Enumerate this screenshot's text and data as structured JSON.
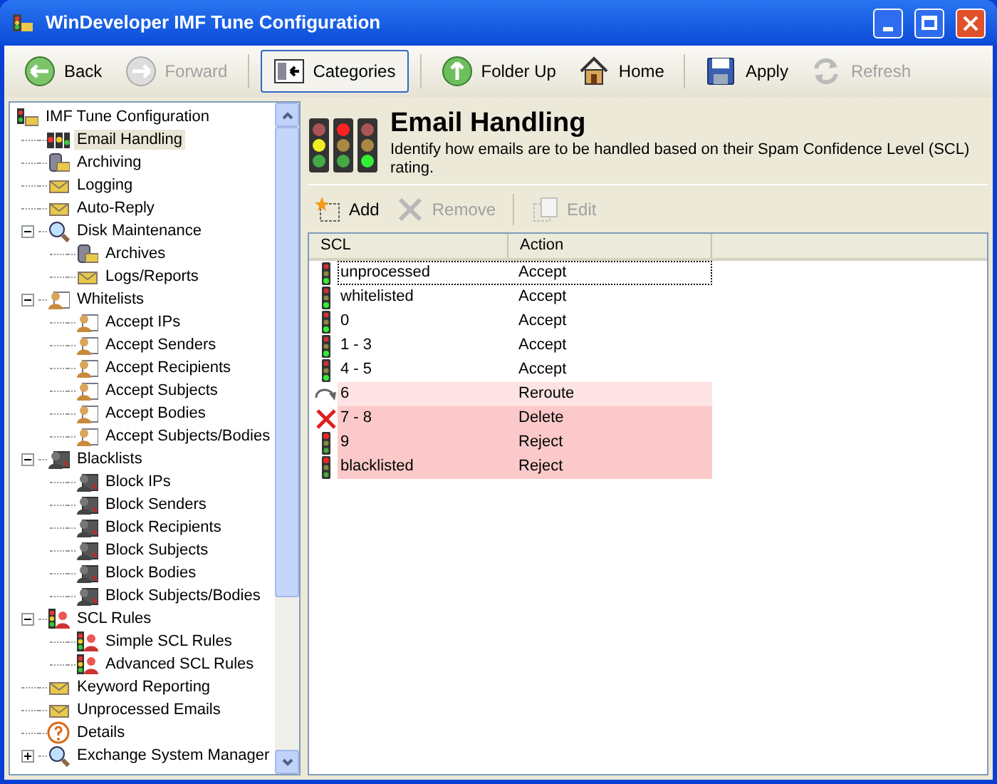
{
  "window": {
    "title": "WinDeveloper IMF Tune Configuration"
  },
  "toolbar": [
    {
      "label": "Back",
      "kind": "back",
      "disabled": false,
      "selected": false
    },
    {
      "label": "Forward",
      "kind": "forward",
      "disabled": true,
      "selected": false
    },
    {
      "label": "Categories",
      "kind": "categories",
      "disabled": false,
      "selected": true
    },
    {
      "label": "Folder Up",
      "kind": "up",
      "disabled": false,
      "selected": false
    },
    {
      "label": "Home",
      "kind": "home",
      "disabled": false,
      "selected": false
    },
    {
      "label": "Apply",
      "kind": "save",
      "disabled": false,
      "selected": false
    },
    {
      "label": "Refresh",
      "kind": "refresh",
      "disabled": true,
      "selected": false
    }
  ],
  "tree": [
    {
      "label": "IMF Tune Configuration",
      "kind": "root",
      "selected": false,
      "children": [
        {
          "label": "Email Handling",
          "kind": "lights",
          "selected": true
        },
        {
          "label": "Archiving",
          "kind": "disk",
          "selected": false
        },
        {
          "label": "Logging",
          "kind": "mail",
          "selected": false
        },
        {
          "label": "Auto-Reply",
          "kind": "mail",
          "selected": false
        },
        {
          "label": "Disk Maintenance",
          "kind": "search",
          "selected": false,
          "expanded": true,
          "children": [
            {
              "label": "Archives",
              "kind": "disk",
              "selected": false
            },
            {
              "label": "Logs/Reports",
              "kind": "mail",
              "selected": false
            }
          ]
        },
        {
          "label": "Whitelists",
          "kind": "person",
          "selected": false,
          "expanded": true,
          "children": [
            {
              "label": "Accept IPs",
              "kind": "person",
              "selected": false
            },
            {
              "label": "Accept Senders",
              "kind": "person",
              "selected": false
            },
            {
              "label": "Accept Recipients",
              "kind": "person",
              "selected": false
            },
            {
              "label": "Accept Subjects",
              "kind": "person",
              "selected": false
            },
            {
              "label": "Accept Bodies",
              "kind": "person",
              "selected": false
            },
            {
              "label": "Accept Subjects/Bodies",
              "kind": "person",
              "selected": false
            }
          ]
        },
        {
          "label": "Blacklists",
          "kind": "blocked",
          "selected": false,
          "expanded": true,
          "children": [
            {
              "label": "Block IPs",
              "kind": "blocked",
              "selected": false
            },
            {
              "label": "Block Senders",
              "kind": "blocked",
              "selected": false
            },
            {
              "label": "Block Recipients",
              "kind": "blocked",
              "selected": false
            },
            {
              "label": "Block Subjects",
              "kind": "blocked",
              "selected": false
            },
            {
              "label": "Block Bodies",
              "kind": "blocked",
              "selected": false
            },
            {
              "label": "Block Subjects/Bodies",
              "kind": "blocked",
              "selected": false
            }
          ]
        },
        {
          "label": "SCL Rules",
          "kind": "rules",
          "selected": false,
          "expanded": true,
          "children": [
            {
              "label": "Simple SCL Rules",
              "kind": "rules",
              "selected": false
            },
            {
              "label": "Advanced SCL Rules",
              "kind": "rules",
              "selected": false
            }
          ]
        },
        {
          "label": "Keyword Reporting",
          "kind": "mail",
          "selected": false
        },
        {
          "label": "Unprocessed Emails",
          "kind": "mail",
          "selected": false
        },
        {
          "label": "Details",
          "kind": "help",
          "selected": false
        },
        {
          "label": "Exchange System Manager",
          "kind": "search",
          "selected": false,
          "expanded": false
        }
      ]
    }
  ],
  "header": {
    "title": "Email Handling",
    "description": "Identify how emails are to be handled based on their Spam Confidence Level (SCL) rating."
  },
  "actions": [
    {
      "label": "Add",
      "kind": "add",
      "disabled": false
    },
    {
      "label": "Remove",
      "kind": "remove",
      "disabled": true
    },
    {
      "label": "Edit",
      "kind": "edit",
      "disabled": true
    }
  ],
  "table": {
    "columns": [
      "SCL",
      "Action"
    ],
    "rows": [
      {
        "scl": "unprocessed",
        "action": "Accept",
        "kind": "green",
        "color": "#ffffff",
        "focused": true
      },
      {
        "scl": "whitelisted",
        "action": "Accept",
        "kind": "green",
        "color": "#ffffff",
        "focused": false
      },
      {
        "scl": "0",
        "action": "Accept",
        "kind": "green",
        "color": "#ffffff",
        "focused": false
      },
      {
        "scl": "1 - 3",
        "action": "Accept",
        "kind": "green",
        "color": "#ffffff",
        "focused": false
      },
      {
        "scl": "4 - 5",
        "action": "Accept",
        "kind": "green",
        "color": "#ffffff",
        "focused": false
      },
      {
        "scl": "6",
        "action": "Reroute",
        "kind": "reroute",
        "color": "#fde3e3",
        "focused": false
      },
      {
        "scl": "7 - 8",
        "action": "Delete",
        "kind": "delete",
        "color": "#fbc9c9",
        "focused": false
      },
      {
        "scl": "9",
        "action": "Reject",
        "kind": "red",
        "color": "#fbc9c9",
        "focused": false
      },
      {
        "scl": "blacklisted",
        "action": "Reject",
        "kind": "red",
        "color": "#fbc9c9",
        "focused": false
      }
    ]
  }
}
